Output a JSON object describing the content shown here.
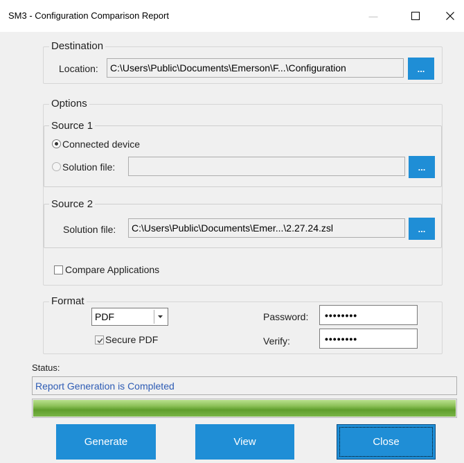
{
  "window": {
    "title": "SM3 - Configuration Comparison Report",
    "minimize_glyph": "—",
    "maximize_glyph": "☐",
    "close_glyph": "✕"
  },
  "destination": {
    "legend": "Destination",
    "location_label": "Location:",
    "location_value": "C:\\Users\\Public\\Documents\\Emerson\\F...\\Configuration",
    "browse_label": "..."
  },
  "options": {
    "legend": "Options",
    "source1": {
      "legend": "Source 1",
      "connected_label": "Connected device",
      "connected_selected": true,
      "solution_label": "Solution file:",
      "solution_value": "",
      "browse_label": "..."
    },
    "source2": {
      "legend": "Source 2",
      "solution_label": "Solution file:",
      "solution_value": "C:\\Users\\Public\\Documents\\Emer...\\2.27.24.zsl",
      "browse_label": "..."
    },
    "compare_apps_label": "Compare Applications",
    "compare_apps_checked": false
  },
  "format": {
    "legend": "Format",
    "selected": "PDF",
    "secure_pdf_label": "Secure PDF",
    "secure_pdf_checked": true,
    "password_label": "Password:",
    "password_value": "••••••••",
    "verify_label": "Verify:",
    "verify_value": "••••••••"
  },
  "status": {
    "label": "Status:",
    "message": "Report Generation is Completed",
    "progress": 1.0
  },
  "buttons": {
    "generate": "Generate",
    "view": "View",
    "close": "Close"
  },
  "colors": {
    "accent": "#1f8ed6",
    "status_text": "#2d5bb4",
    "progress": "#6aa535"
  }
}
